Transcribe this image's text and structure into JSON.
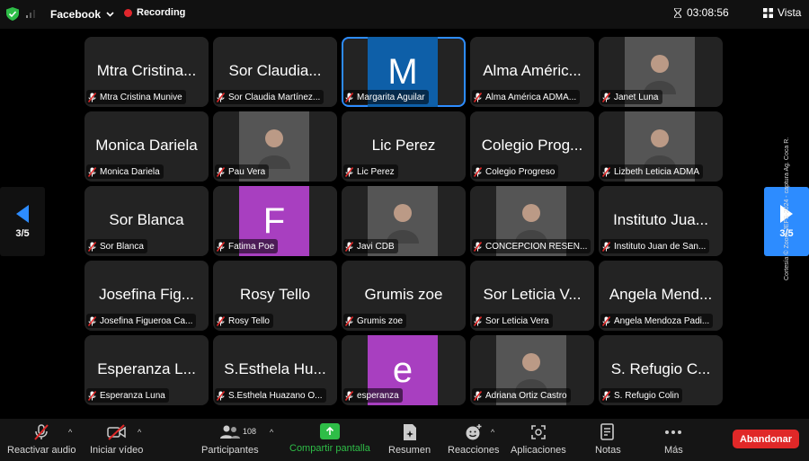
{
  "topbar": {
    "stream_target": "Facebook",
    "recording_label": "Recording",
    "timer": "03:08:56",
    "view_label": "Vista"
  },
  "pager": {
    "current": "3/5"
  },
  "participants": [
    {
      "tile_text": "Mtra Cristina...",
      "name": "Mtra Cristina Munive",
      "avatar": "text"
    },
    {
      "tile_text": "Sor Claudia...",
      "name": "Sor Claudia Martínez...",
      "avatar": "text"
    },
    {
      "tile_text": "M",
      "name": "Margarita Aguilar",
      "avatar": "blue",
      "active": true
    },
    {
      "tile_text": "Alma Améric...",
      "name": "Alma América ADMA...",
      "avatar": "text"
    },
    {
      "tile_text": "",
      "name": "Janet Luna",
      "avatar": "photo"
    },
    {
      "tile_text": "Monica Dariela",
      "name": "Monica Dariela",
      "avatar": "text"
    },
    {
      "tile_text": "",
      "name": "Pau Vera",
      "avatar": "photo"
    },
    {
      "tile_text": "Lic Perez",
      "name": "Lic Perez",
      "avatar": "text"
    },
    {
      "tile_text": "Colegio Prog...",
      "name": "Colegio Progreso",
      "avatar": "text"
    },
    {
      "tile_text": "",
      "name": "Lizbeth Leticia ADMA",
      "avatar": "photo"
    },
    {
      "tile_text": "Sor Blanca",
      "name": "Sor Blanca",
      "avatar": "text"
    },
    {
      "tile_text": "F",
      "name": "Fatima Poe",
      "avatar": "purple"
    },
    {
      "tile_text": "",
      "name": "Javi CDB",
      "avatar": "photo"
    },
    {
      "tile_text": "",
      "name": "CONCEPCION RESEN...",
      "avatar": "photo"
    },
    {
      "tile_text": "Instituto Jua...",
      "name": "Instituto Juan de San...",
      "avatar": "text"
    },
    {
      "tile_text": "Josefina Fig...",
      "name": "Josefina Figueroa Ca...",
      "avatar": "text"
    },
    {
      "tile_text": "Rosy Tello",
      "name": "Rosy Tello",
      "avatar": "text"
    },
    {
      "tile_text": "Grumis zoe",
      "name": "Grumis zoe",
      "avatar": "text"
    },
    {
      "tile_text": "Sor Leticia V...",
      "name": "Sor Leticia Vera",
      "avatar": "text"
    },
    {
      "tile_text": "Angela Mend...",
      "name": "Angela Mendoza Padi...",
      "avatar": "text"
    },
    {
      "tile_text": "Esperanza L...",
      "name": "Esperanza Luna",
      "avatar": "text"
    },
    {
      "tile_text": "S.Esthela Hu...",
      "name": "S.Esthela Huazano O...",
      "avatar": "text"
    },
    {
      "tile_text": "e",
      "name": "esperanza",
      "avatar": "purple"
    },
    {
      "tile_text": "",
      "name": "Adriana Ortiz Castro",
      "avatar": "photo"
    },
    {
      "tile_text": "S. Refugio C...",
      "name": "S. Refugio Colin",
      "avatar": "text"
    }
  ],
  "toolbar": {
    "unmute": "Reactivar audio",
    "start_video": "Iniciar vídeo",
    "participants": "Participantes",
    "participant_count": "108",
    "share": "Compartir pantalla",
    "summary": "Resumen",
    "reactions": "Reacciones",
    "apps": "Aplicaciones",
    "notes": "Notas",
    "more": "Más",
    "leave": "Abandonar"
  },
  "credit": "Cortesía © Zoom JEFS-2024 - captura Ag. Coca R.",
  "colors": {
    "accent": "#2d8cff",
    "share_green": "#2ebd47",
    "leave_red": "#e02828",
    "blue_avatar": "#0e5fa8",
    "purple_avatar": "#a83fc0"
  }
}
